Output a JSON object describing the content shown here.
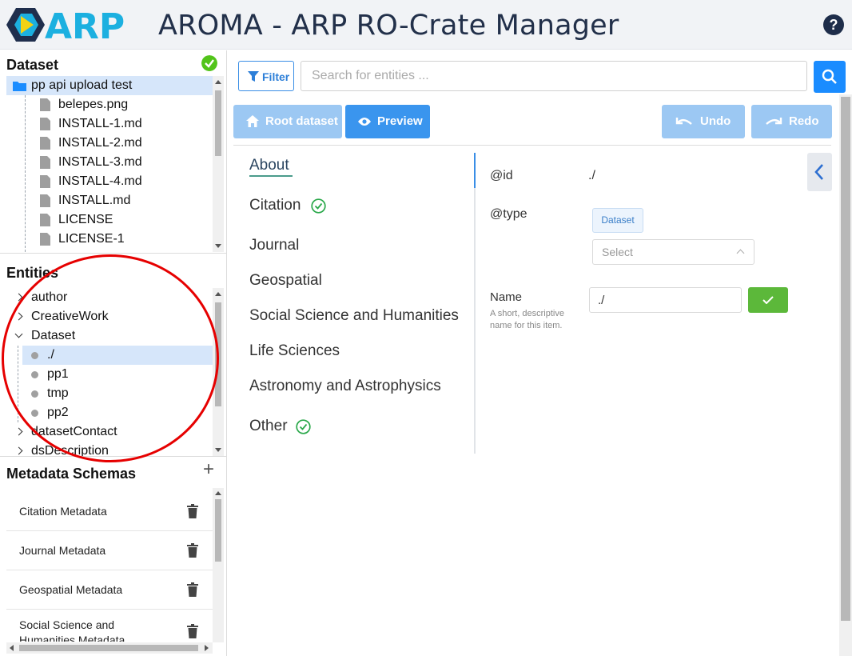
{
  "header": {
    "logo_text": "ARP",
    "title": "AROMA - ARP RO-Crate Manager",
    "help_icon": "question-circle-icon"
  },
  "dataset": {
    "title": "Dataset",
    "status_icon": "check-circle-icon",
    "root": "pp api upload test",
    "files": [
      "belepes.png",
      "INSTALL-1.md",
      "INSTALL-2.md",
      "INSTALL-3.md",
      "INSTALL-4.md",
      "INSTALL.md",
      "LICENSE",
      "LICENSE-1"
    ]
  },
  "entities": {
    "title": "Entities",
    "items": [
      "author",
      "CreativeWork",
      "Dataset"
    ],
    "dataset_children": [
      "./",
      "pp1",
      "tmp",
      "pp2"
    ],
    "after_items": [
      "datasetContact",
      "dsDescription"
    ]
  },
  "schemas": {
    "title": "Metadata Schemas",
    "add_icon": "plus-icon",
    "items": [
      "Citation Metadata",
      "Journal Metadata",
      "Geospatial Metadata",
      "Social Science and Humanities Metadata"
    ]
  },
  "toolbar": {
    "filter_label": "Filter",
    "search_placeholder": "Search for entities ...",
    "root_label": "Root dataset",
    "preview_label": "Preview",
    "undo_label": "Undo",
    "redo_label": "Redo"
  },
  "categories": [
    "About",
    "Citation",
    "Journal",
    "Geospatial",
    "Social Science and Humanities",
    "Life Sciences",
    "Astronomy and Astrophysics",
    "Other"
  ],
  "properties": {
    "id_label": "@id",
    "id_value": "./",
    "type_label": "@type",
    "type_tag": "Dataset",
    "type_select_placeholder": "Select",
    "name_label": "Name",
    "name_desc": "A short, descriptive name for this item.",
    "name_value": "./"
  },
  "colors": {
    "accent": "#1a8cff",
    "success": "#52c41a",
    "annotation": "#e60000"
  }
}
